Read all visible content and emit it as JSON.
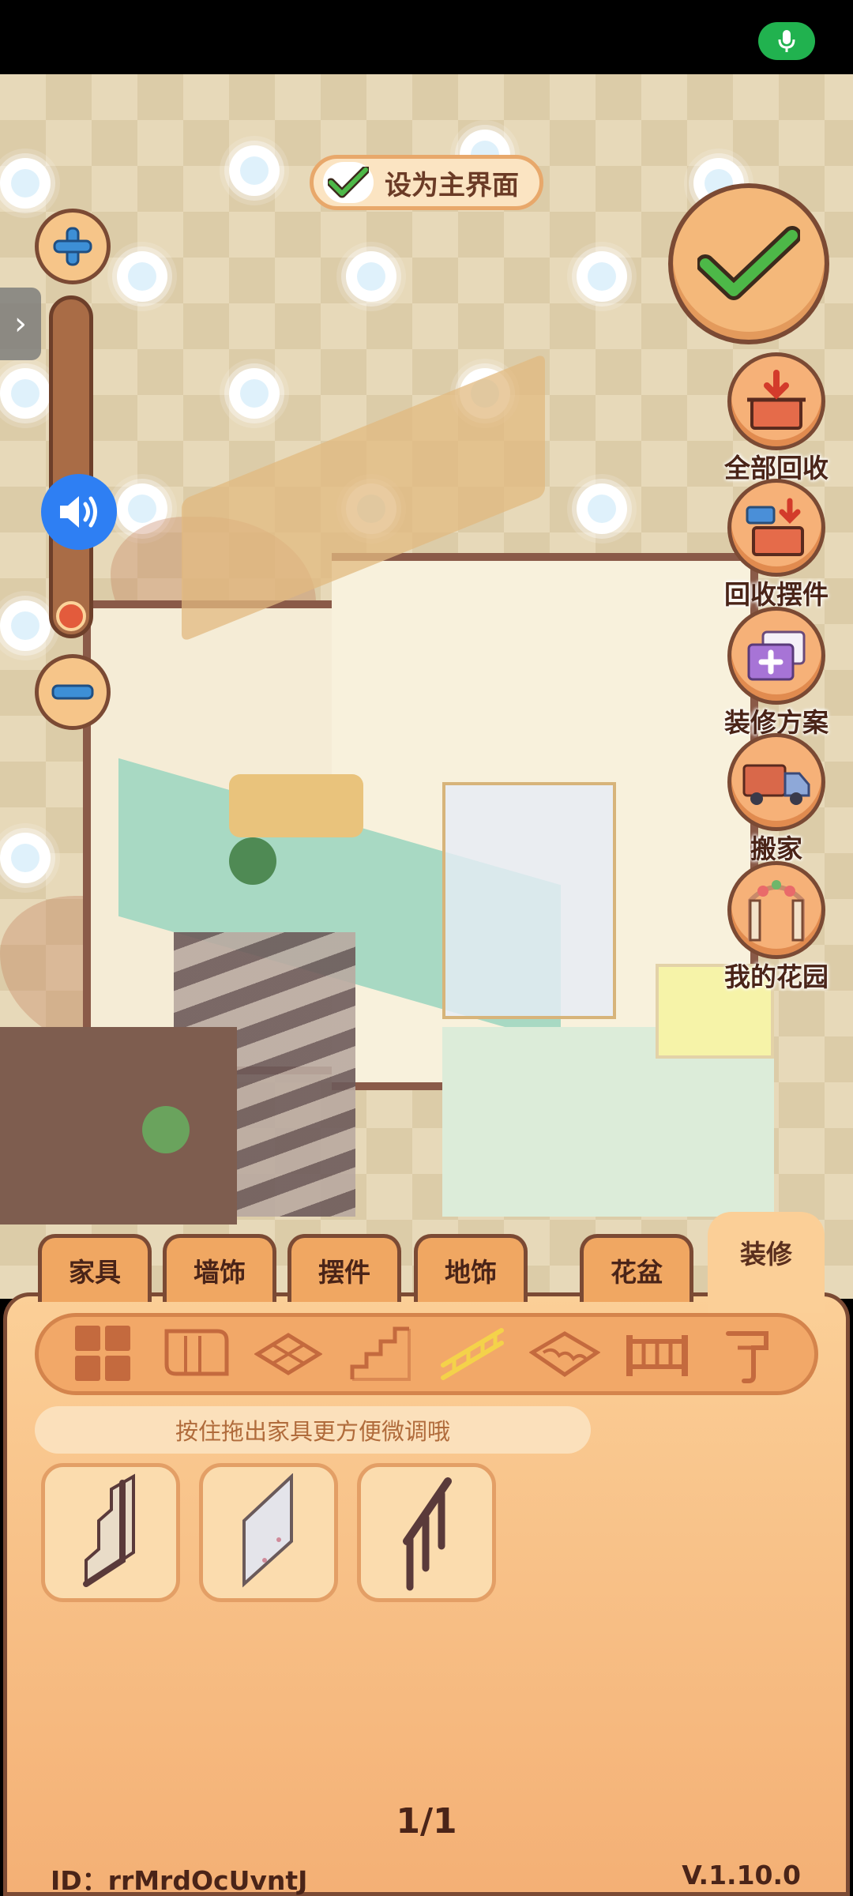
{
  "top_toggle": {
    "label": "设为主界面",
    "checked": true
  },
  "right_actions": [
    {
      "label": "全部回收",
      "icon": "box-recycle-icon"
    },
    {
      "label": "回收摆件",
      "icon": "box-item-recycle-icon"
    },
    {
      "label": "装修方案",
      "icon": "cards-plus-icon"
    },
    {
      "label": "搬家",
      "icon": "moving-truck-icon"
    },
    {
      "label": "我的花园",
      "icon": "garden-arch-icon"
    }
  ],
  "tabs": [
    "家具",
    "墙饰",
    "摆件",
    "地饰",
    "花盆",
    "装修"
  ],
  "active_tab": "装修",
  "categories": [
    {
      "icon": "grid-icon",
      "selected": false
    },
    {
      "icon": "wallpaper-roll-icon",
      "selected": false
    },
    {
      "icon": "floor-tile-icon",
      "selected": false
    },
    {
      "icon": "stairs-icon",
      "selected": false
    },
    {
      "icon": "railing-icon",
      "selected": true
    },
    {
      "icon": "roof-tile-icon",
      "selected": false
    },
    {
      "icon": "fence-icon",
      "selected": false
    },
    {
      "icon": "hook-icon",
      "selected": false
    }
  ],
  "hint": "按住拖出家具更方便微调哦",
  "items": [
    {
      "icon": "stair-railing-dark-icon"
    },
    {
      "icon": "stair-railing-glass-icon"
    },
    {
      "icon": "stair-railing-post-icon"
    }
  ],
  "pagination": "1/1",
  "footer": {
    "id": "ID：rrMrdOcUvntJ",
    "version": "V.1.10.0"
  },
  "colors": {
    "accent": "#f4b87a",
    "outline": "#7b4a34",
    "check": "#4db848",
    "mic": "#21b24f",
    "speaker": "#2e7ff3"
  }
}
